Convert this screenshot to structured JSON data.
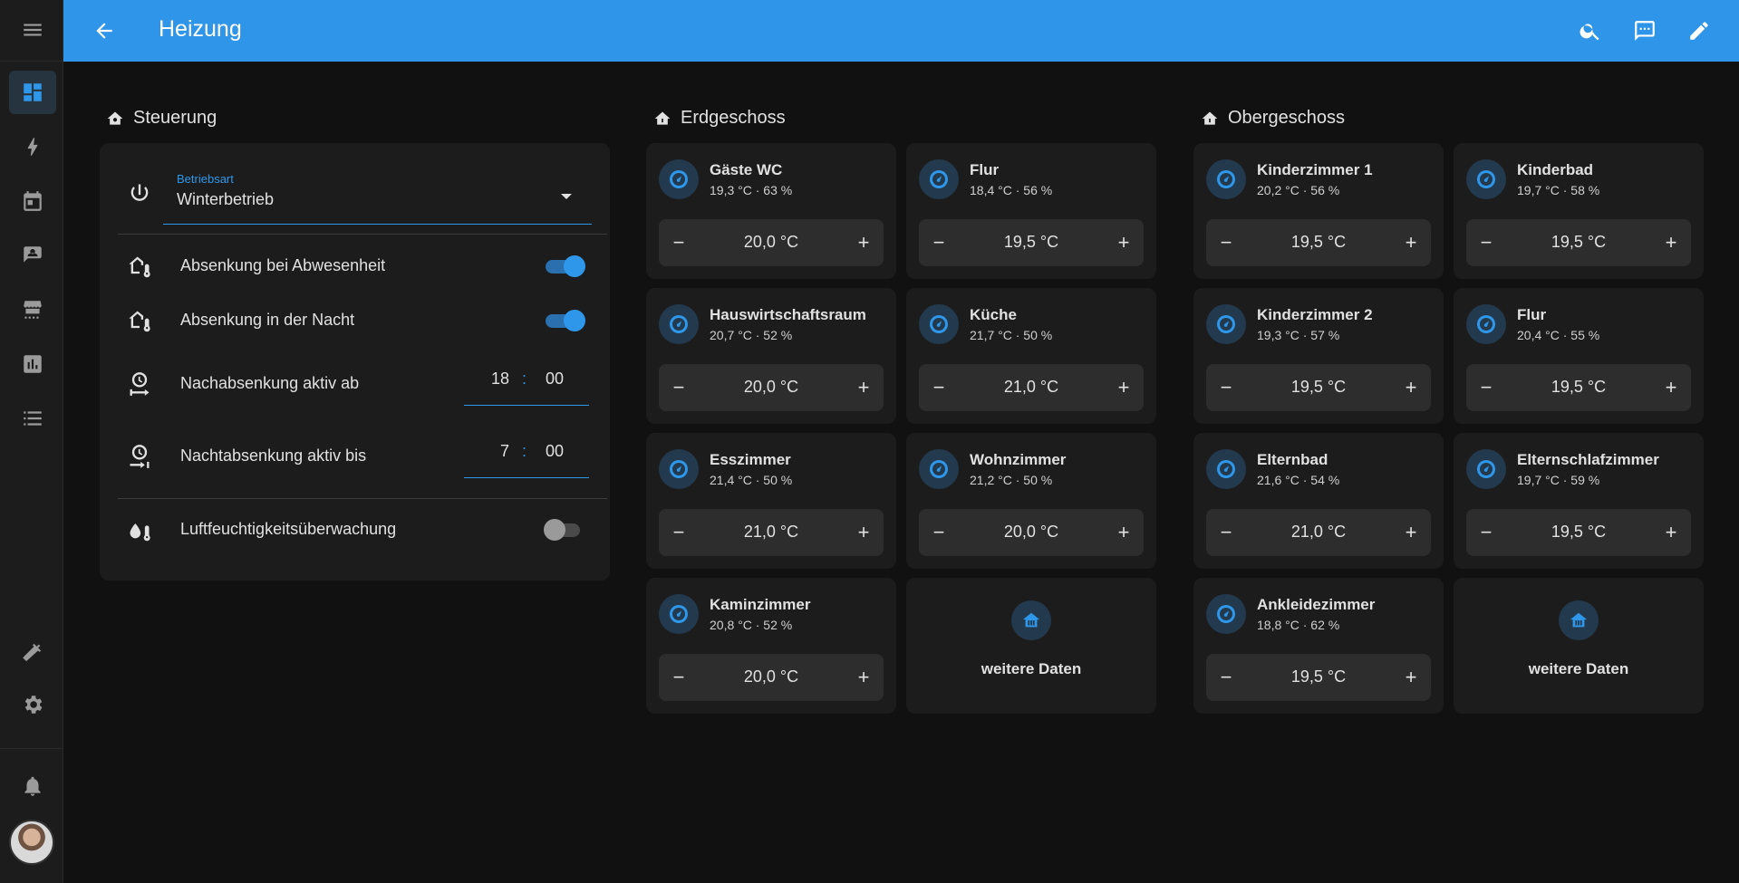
{
  "header": {
    "title": "Heizung"
  },
  "sidebar": {
    "items": [
      {
        "icon": "menu-icon"
      },
      {
        "icon": "dashboard-icon"
      },
      {
        "icon": "energy-icon"
      },
      {
        "icon": "calendar-icon"
      },
      {
        "icon": "map-icon"
      },
      {
        "icon": "hacs-icon"
      },
      {
        "icon": "history-icon"
      },
      {
        "icon": "logbook-icon"
      },
      {
        "icon": "developer-tools-icon"
      },
      {
        "icon": "settings-icon"
      },
      {
        "icon": "notifications-icon"
      }
    ]
  },
  "steuerung": {
    "title": "Steuerung",
    "mode_caption": "Betriebsart",
    "mode_value": "Winterbetrieb",
    "absence_label": "Absenkung bei Abwesenheit",
    "absence_on": true,
    "night_label": "Absenkung in der Nacht",
    "night_on": true,
    "from_label": "Nachabsenkung aktiv ab",
    "from_hour": "18",
    "from_minute": "00",
    "to_label": "Nachtabsenkung aktiv bis",
    "to_hour": "7",
    "to_minute": "00",
    "time_sep": ":",
    "humidity_label": "Luftfeuchtigkeitsüberwachung",
    "humidity_on": false
  },
  "erdgeschoss": {
    "title": "Erdgeschoss",
    "rooms": [
      {
        "name": "Gäste WC",
        "state": "19,3 °C · 63 %",
        "target": "20,0 °C"
      },
      {
        "name": "Flur",
        "state": "18,4 °C · 56 %",
        "target": "19,5 °C"
      },
      {
        "name": "Hauswirtschaftsraum",
        "state": "20,7 °C · 52 %",
        "target": "20,0 °C"
      },
      {
        "name": "Küche",
        "state": "21,7 °C · 50 %",
        "target": "21,0 °C"
      },
      {
        "name": "Esszimmer",
        "state": "21,4 °C · 50 %",
        "target": "21,0 °C"
      },
      {
        "name": "Wohnzimmer",
        "state": "21,2 °C · 50 %",
        "target": "20,0 °C"
      },
      {
        "name": "Kaminzimmer",
        "state": "20,8 °C · 52 %",
        "target": "20,0 °C"
      }
    ],
    "more_label": "weitere Daten"
  },
  "obergeschoss": {
    "title": "Obergeschoss",
    "rooms": [
      {
        "name": "Kinderzimmer 1",
        "state": "20,2 °C · 56 %",
        "target": "19,5 °C"
      },
      {
        "name": "Kinderbad",
        "state": "19,7 °C · 58 %",
        "target": "19,5 °C"
      },
      {
        "name": "Kinderzimmer 2",
        "state": "19,3 °C · 57 %",
        "target": "19,5 °C"
      },
      {
        "name": "Flur",
        "state": "20,4 °C · 55 %",
        "target": "19,5 °C"
      },
      {
        "name": "Elternbad",
        "state": "21,6 °C · 54 %",
        "target": "21,0 °C"
      },
      {
        "name": "Elternschlafzimmer",
        "state": "19,7 °C · 59 %",
        "target": "19,5 °C"
      },
      {
        "name": "Ankleidezimmer",
        "state": "18,8 °C · 62 %",
        "target": "19,5 °C"
      }
    ],
    "more_label": "weitere Daten"
  },
  "stepper": {
    "minus": "−",
    "plus": "+"
  }
}
